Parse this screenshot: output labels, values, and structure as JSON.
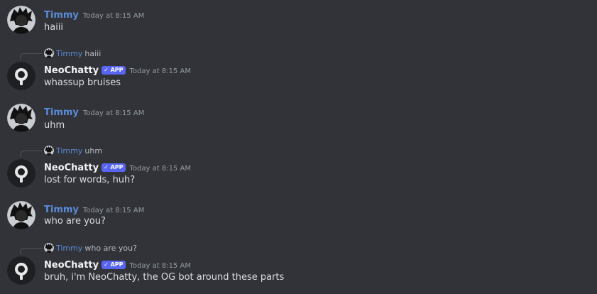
{
  "messages": [
    {
      "username": "Timmy",
      "timestamp": "Today at 8:15 AM",
      "content": "haiii"
    },
    {
      "reply_to": {
        "username": "Timmy",
        "text": "haiii"
      },
      "username": "NeoChatty",
      "badge": "✓ APP",
      "timestamp": "Today at 8:15 AM",
      "content": "whassup bruises"
    },
    {
      "username": "Timmy",
      "timestamp": "Today at 8:15 AM",
      "content": "uhm"
    },
    {
      "reply_to": {
        "username": "Timmy",
        "text": "uhm"
      },
      "username": "NeoChatty",
      "badge": "✓ APP",
      "timestamp": "Today at 8:15 AM",
      "content": "lost for words, huh?"
    },
    {
      "username": "Timmy",
      "timestamp": "Today at 8:15 AM",
      "content": "who are you?"
    },
    {
      "reply_to": {
        "username": "Timmy",
        "text": "who are you?"
      },
      "username": "NeoChatty",
      "badge": "✓ APP",
      "timestamp": "Today at 8:15 AM",
      "content": "bruh, i'm NeoChatty, the OG bot around these parts"
    }
  ],
  "colors": {
    "background": "#313338",
    "user_name": "#5b8bd6",
    "bot_name": "#f2f3f5",
    "app_badge": "#5865f2",
    "message_text": "#dbdee1",
    "timestamp": "#949ba4"
  },
  "icons": {
    "user_avatar": "anime-avatar-icon",
    "bot_avatar": "neochatty-bot-avatar-icon"
  }
}
